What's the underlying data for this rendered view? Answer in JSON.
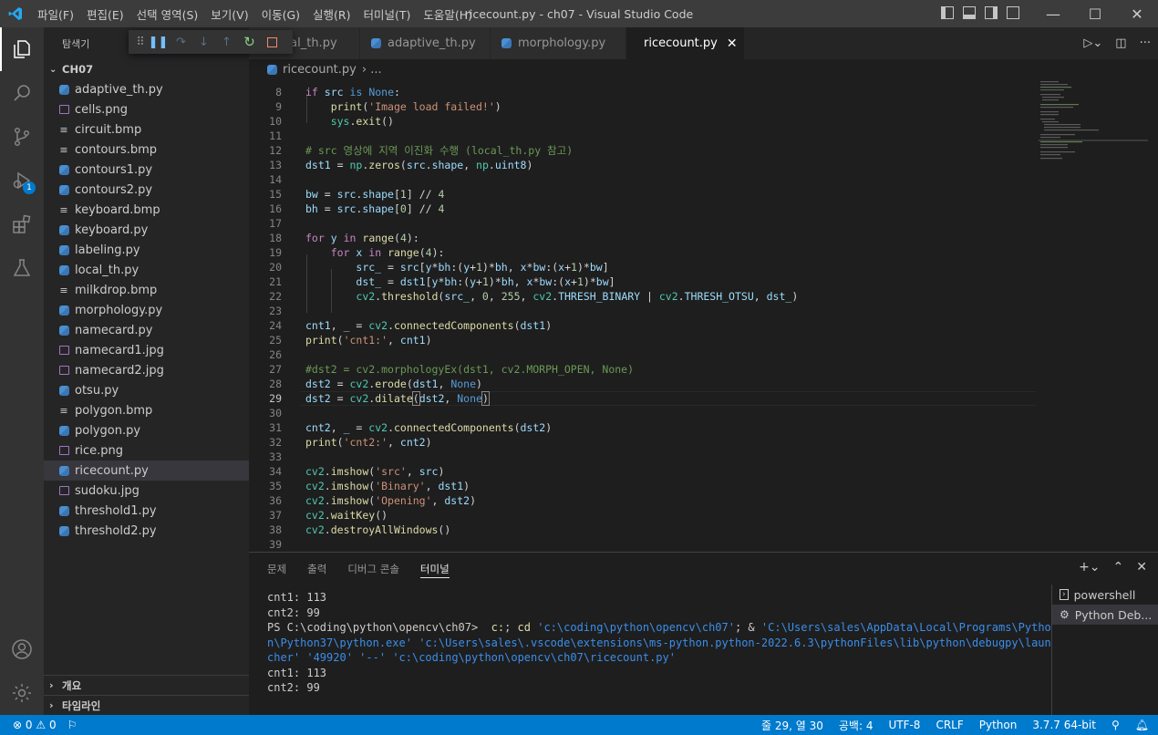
{
  "titlebar": {
    "menu": [
      "파일(F)",
      "편집(E)",
      "선택 영역(S)",
      "보기(V)",
      "이동(G)",
      "실행(R)",
      "터미널(T)",
      "도움말(H)"
    ],
    "title": "ricecount.py - ch07 - Visual Studio Code",
    "minimize": "—",
    "maximize": "☐",
    "close": "✕"
  },
  "sidebar": {
    "header": "탐색기",
    "folder": "CH07",
    "files": [
      {
        "name": "adaptive_th.py",
        "type": "py"
      },
      {
        "name": "cells.png",
        "type": "img"
      },
      {
        "name": "circuit.bmp",
        "type": "bmp"
      },
      {
        "name": "contours.bmp",
        "type": "bmp"
      },
      {
        "name": "contours1.py",
        "type": "py"
      },
      {
        "name": "contours2.py",
        "type": "py"
      },
      {
        "name": "keyboard.bmp",
        "type": "bmp"
      },
      {
        "name": "keyboard.py",
        "type": "py"
      },
      {
        "name": "labeling.py",
        "type": "py"
      },
      {
        "name": "local_th.py",
        "type": "py"
      },
      {
        "name": "milkdrop.bmp",
        "type": "bmp"
      },
      {
        "name": "morphology.py",
        "type": "py"
      },
      {
        "name": "namecard.py",
        "type": "py"
      },
      {
        "name": "namecard1.jpg",
        "type": "img"
      },
      {
        "name": "namecard2.jpg",
        "type": "img"
      },
      {
        "name": "otsu.py",
        "type": "py"
      },
      {
        "name": "polygon.bmp",
        "type": "bmp"
      },
      {
        "name": "polygon.py",
        "type": "py"
      },
      {
        "name": "rice.png",
        "type": "img"
      },
      {
        "name": "ricecount.py",
        "type": "py",
        "selected": true
      },
      {
        "name": "sudoku.jpg",
        "type": "img"
      },
      {
        "name": "threshold1.py",
        "type": "py"
      },
      {
        "name": "threshold2.py",
        "type": "py"
      }
    ],
    "outline": "개요",
    "timeline": "타임라인"
  },
  "activity": {
    "debug_badge": "1"
  },
  "tabs": [
    {
      "label": "local_th.py",
      "visible_label": "cal_th.py"
    },
    {
      "label": "adaptive_th.py"
    },
    {
      "label": "morphology.py"
    },
    {
      "label": "ricecount.py",
      "active": true
    }
  ],
  "breadcrumb": {
    "file": "ricecount.py",
    "sep": "› ..."
  },
  "editor": {
    "current_line": 29,
    "lines": [
      {
        "n": 8,
        "html": "<span class=\"k\">if</span> <span class=\"v\">src</span> <span class=\"kb\">is</span> <span class=\"kb\">None</span>:"
      },
      {
        "n": 9,
        "html": "    <span class=\"f\">print</span>(<span class=\"s\">'Image load failed!'</span>)"
      },
      {
        "n": 10,
        "html": "    <span class=\"t\">sys</span>.<span class=\"f\">exit</span>()"
      },
      {
        "n": 11,
        "html": ""
      },
      {
        "n": 12,
        "html": "<span class=\"c\"># src 영상에 지역 이진화 수행 (local_th.py 참고)</span>"
      },
      {
        "n": 13,
        "html": "<span class=\"v\">dst1</span> = <span class=\"t\">np</span>.<span class=\"f\">zeros</span>(<span class=\"v\">src</span>.<span class=\"v\">shape</span>, <span class=\"t\">np</span>.<span class=\"v\">uint8</span>)"
      },
      {
        "n": 14,
        "html": ""
      },
      {
        "n": 15,
        "html": "<span class=\"v\">bw</span> = <span class=\"v\">src</span>.<span class=\"v\">shape</span>[<span class=\"n\">1</span>] // <span class=\"n\">4</span>"
      },
      {
        "n": 16,
        "html": "<span class=\"v\">bh</span> = <span class=\"v\">src</span>.<span class=\"v\">shape</span>[<span class=\"n\">0</span>] // <span class=\"n\">4</span>"
      },
      {
        "n": 17,
        "html": ""
      },
      {
        "n": 18,
        "html": "<span class=\"k\">for</span> <span class=\"v\">y</span> <span class=\"k\">in</span> <span class=\"f\">range</span>(<span class=\"n\">4</span>):"
      },
      {
        "n": 19,
        "html": "    <span class=\"k\">for</span> <span class=\"v\">x</span> <span class=\"k\">in</span> <span class=\"f\">range</span>(<span class=\"n\">4</span>):"
      },
      {
        "n": 20,
        "html": "        <span class=\"v\">src_</span> = <span class=\"v\">src</span>[<span class=\"v\">y</span>*<span class=\"v\">bh</span>:(<span class=\"v\">y</span>+<span class=\"n\">1</span>)*<span class=\"v\">bh</span>, <span class=\"v\">x</span>*<span class=\"v\">bw</span>:(<span class=\"v\">x</span>+<span class=\"n\">1</span>)*<span class=\"v\">bw</span>]"
      },
      {
        "n": 21,
        "html": "        <span class=\"v\">dst_</span> = <span class=\"v\">dst1</span>[<span class=\"v\">y</span>*<span class=\"v\">bh</span>:(<span class=\"v\">y</span>+<span class=\"n\">1</span>)*<span class=\"v\">bh</span>, <span class=\"v\">x</span>*<span class=\"v\">bw</span>:(<span class=\"v\">x</span>+<span class=\"n\">1</span>)*<span class=\"v\">bw</span>]"
      },
      {
        "n": 22,
        "html": "        <span class=\"t\">cv2</span>.<span class=\"f\">threshold</span>(<span class=\"v\">src_</span>, <span class=\"n\">0</span>, <span class=\"n\">255</span>, <span class=\"t\">cv2</span>.<span class=\"v\">THRESH_BINARY</span> | <span class=\"t\">cv2</span>.<span class=\"v\">THRESH_OTSU</span>, <span class=\"v\">dst_</span>)"
      },
      {
        "n": 23,
        "html": ""
      },
      {
        "n": 24,
        "html": "<span class=\"v\">cnt1</span>, <span class=\"v\">_</span> = <span class=\"t\">cv2</span>.<span class=\"f\">connectedComponents</span>(<span class=\"v\">dst1</span>)"
      },
      {
        "n": 25,
        "html": "<span class=\"f\">print</span>(<span class=\"s\">'cnt1:'</span>, <span class=\"v\">cnt1</span>)"
      },
      {
        "n": 26,
        "html": ""
      },
      {
        "n": 27,
        "html": "<span class=\"c\">#dst2 = cv2.morphologyEx(dst1, cv2.MORPH_OPEN, None)</span>"
      },
      {
        "n": 28,
        "html": "<span class=\"v\">dst2</span> = <span class=\"t\">cv2</span>.<span class=\"f\">erode</span>(<span class=\"v\">dst1</span>, <span class=\"kb\">None</span>)"
      },
      {
        "n": 29,
        "html": "<span class=\"v\">dst2</span> = <span class=\"t\">cv2</span>.<span class=\"f\">dilate</span><span style=\"outline:1px solid #888\">(</span><span class=\"v\">dst2</span>, <span class=\"kb\">None</span><span style=\"outline:1px solid #888\">)</span>"
      },
      {
        "n": 30,
        "html": ""
      },
      {
        "n": 31,
        "html": "<span class=\"v\">cnt2</span>, <span class=\"v\">_</span> = <span class=\"t\">cv2</span>.<span class=\"f\">connectedComponents</span>(<span class=\"v\">dst2</span>)"
      },
      {
        "n": 32,
        "html": "<span class=\"f\">print</span>(<span class=\"s\">'cnt2:'</span>, <span class=\"v\">cnt2</span>)"
      },
      {
        "n": 33,
        "html": ""
      },
      {
        "n": 34,
        "html": "<span class=\"t\">cv2</span>.<span class=\"f\">imshow</span>(<span class=\"s\">'src'</span>, <span class=\"v\">src</span>)"
      },
      {
        "n": 35,
        "html": "<span class=\"t\">cv2</span>.<span class=\"f\">imshow</span>(<span class=\"s\">'Binary'</span>, <span class=\"v\">dst1</span>)"
      },
      {
        "n": 36,
        "html": "<span class=\"t\">cv2</span>.<span class=\"f\">imshow</span>(<span class=\"s\">'Opening'</span>, <span class=\"v\">dst2</span>)"
      },
      {
        "n": 37,
        "html": "<span class=\"t\">cv2</span>.<span class=\"f\">waitKey</span>()"
      },
      {
        "n": 38,
        "html": "<span class=\"t\">cv2</span>.<span class=\"f\">destroyAllWindows</span>()"
      },
      {
        "n": 39,
        "html": ""
      }
    ]
  },
  "panel": {
    "tabs": [
      "문제",
      "출력",
      "디버그 콘솔",
      "터미널"
    ],
    "active_tab": "터미널",
    "terminal_html": "cnt1: 113\ncnt2: 99\nPS C:\\coding\\python\\opencv\\ch07&gt;  <span class=\"y\">c:</span>; <span class=\"y\">cd</span> <span class=\"q\">'c:\\coding\\python\\opencv\\ch07'</span>; &amp; <span class=\"q\">'C:\\Users\\sales\\AppData\\Local\\Programs\\Python\\Python37\\python.exe'</span> <span class=\"q\">'c:\\Users\\sales\\.vscode\\extensions\\ms-python.python-2022.6.3\\pythonFiles\\lib\\python\\debugpy\\launcher'</span> <span class=\"q\">'49920'</span> <span class=\"q\">'--'</span> <span class=\"q\">'c:\\coding\\python\\opencv\\ch07\\ricecount.py'</span>\ncnt1: 113\ncnt2: 99",
    "terminals": [
      {
        "label": "powershell",
        "icon": "terminal-icon"
      },
      {
        "label": "Python Deb...",
        "icon": "debug-gear-icon",
        "active": true
      }
    ]
  },
  "statusbar": {
    "errors": "0",
    "warnings": "0",
    "position": "줄 29, 열 30",
    "spaces": "공백: 4",
    "encoding": "UTF-8",
    "eol": "CRLF",
    "language": "Python",
    "interpreter": "3.7.7 64-bit"
  }
}
